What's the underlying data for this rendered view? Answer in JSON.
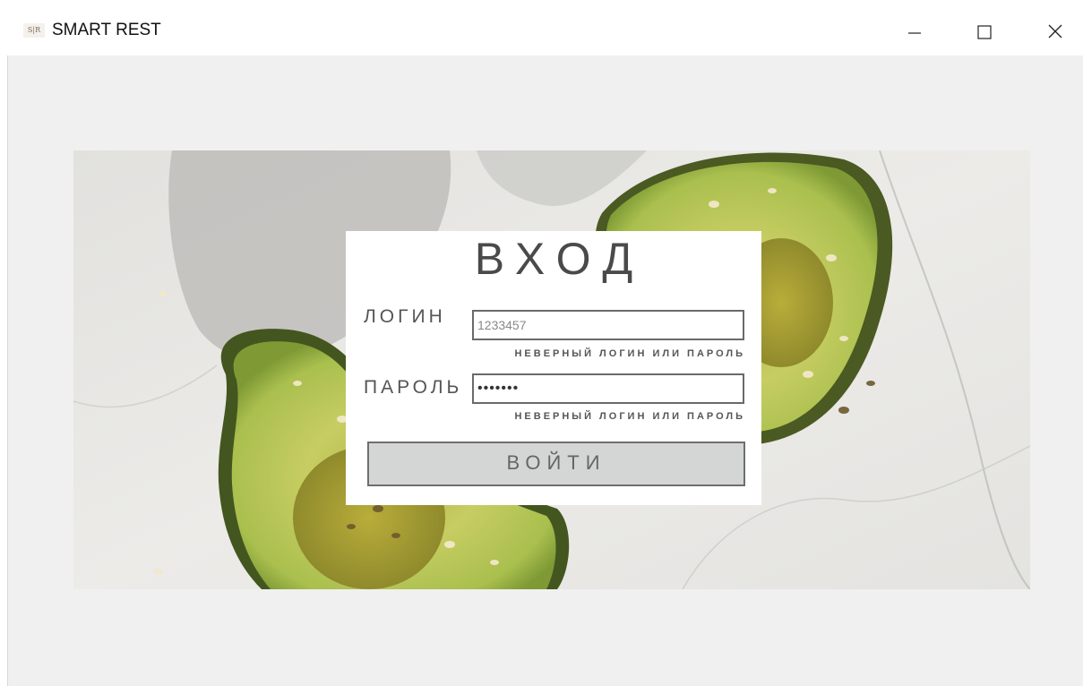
{
  "window": {
    "title": "SMART REST",
    "icon_text": "S|R",
    "controls": {
      "minimize": "minimize-icon",
      "maximize": "maximize-icon",
      "close": "close-icon"
    }
  },
  "login_form": {
    "heading": "ВХОД",
    "login_label": "ЛОГИН",
    "login_value": "1233457",
    "login_error": "НЕВЕРНЫЙ ЛОГИН ИЛИ ПАРОЛЬ",
    "password_label": "ПАРОЛЬ",
    "password_value": "•••••••",
    "password_error": "НЕВЕРНЫЙ ЛОГИН ИЛИ ПАРОЛЬ",
    "submit_label": "ВОЙТИ"
  },
  "colors": {
    "client_bg": "#f0f0f0",
    "button_bg": "#d3d6d5",
    "avocado_flesh": "#c9cf6a",
    "avocado_skin": "#3f5a1e"
  }
}
